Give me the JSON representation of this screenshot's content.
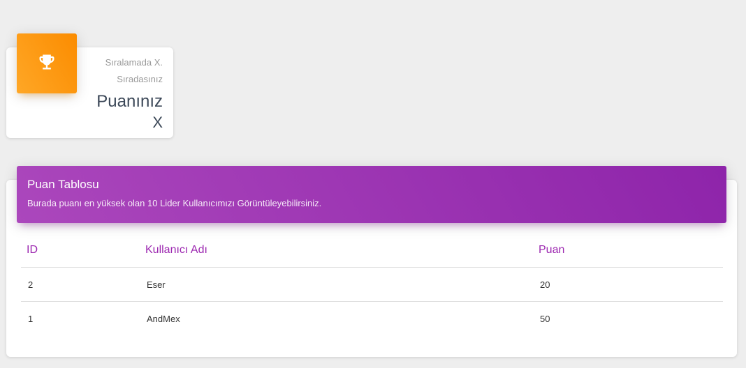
{
  "stats_card": {
    "icon": "trophy-icon",
    "icon_color": "#ffffff",
    "accent_color": "#fb8c00",
    "category": "Sıralamada X. Sıradasınız",
    "title": "Puanınız",
    "value": "X"
  },
  "scoreboard": {
    "accent_color": "#9c27b0",
    "title": "Puan Tablosu",
    "description": "Burada puanı en yüksek olan 10 Lider Kullanıcımızı Görüntüleyebilirsiniz.",
    "columns": [
      "ID",
      "Kullanıcı Adı",
      "Puan"
    ],
    "rows": [
      {
        "id": "2",
        "username": "Eser",
        "score": "20"
      },
      {
        "id": "1",
        "username": "AndMex",
        "score": "50"
      }
    ]
  }
}
